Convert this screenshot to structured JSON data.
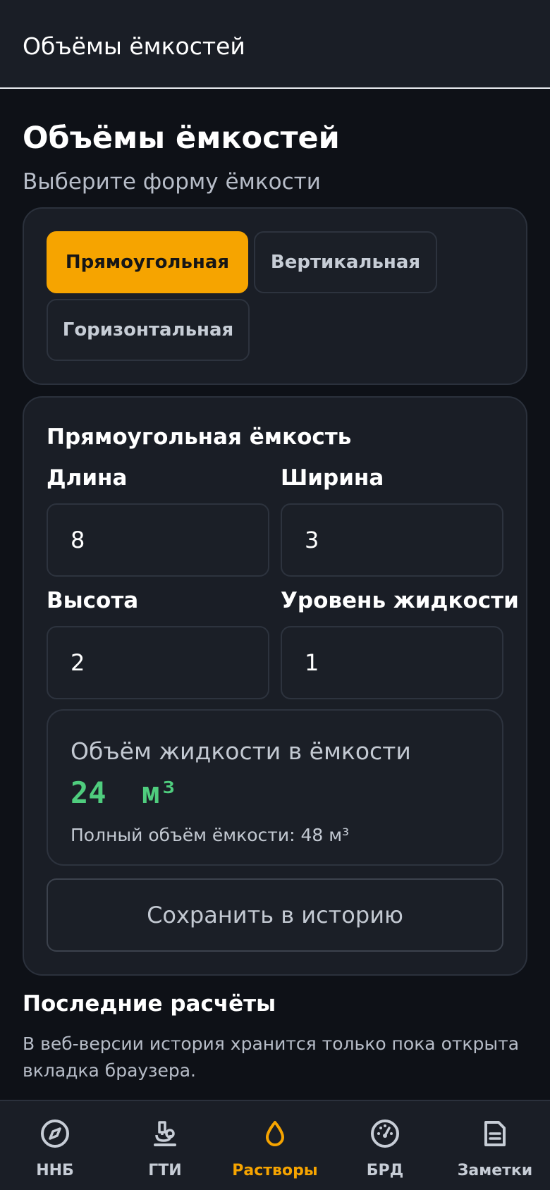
{
  "app_bar": {
    "title": "Объёмы ёмкостей"
  },
  "header": {
    "title": "Объёмы ёмкостей",
    "subtitle": "Выберите форму ёмкости"
  },
  "shapes": {
    "selected": "Прямоугольная",
    "rectangular": "Прямоугольная",
    "vertical": "Вертикальная",
    "horizontal": "Горизонтальная"
  },
  "calculator": {
    "title": "Прямоугольная ёмкость",
    "length": {
      "label": "Длина",
      "value": "8"
    },
    "width": {
      "label": "Ширина",
      "value": "3"
    },
    "height": {
      "label": "Высота",
      "value": "2"
    },
    "level": {
      "label": "Уровень жидкости",
      "value": "1"
    }
  },
  "result": {
    "label": "Объём жидкости в ёмкости",
    "value": "24  м³",
    "total": "Полный объём ёмкости: 48 м³"
  },
  "save_button": "Сохранить в историю",
  "history": {
    "title": "Последние расчёты",
    "note": "В веб-версии история хранится только пока открыта вкладка браузера."
  },
  "nav": {
    "active": "Растворы",
    "items": [
      {
        "label": "ННБ",
        "icon": "compass-icon"
      },
      {
        "label": "ГТИ",
        "icon": "microscope-icon"
      },
      {
        "label": "Растворы",
        "icon": "drop-icon"
      },
      {
        "label": "БРД",
        "icon": "gauge-icon"
      },
      {
        "label": "Заметки",
        "icon": "note-icon"
      }
    ]
  },
  "colors": {
    "accent": "#f6a400",
    "result": "#4fcd7e",
    "background": "#0e1117",
    "surface": "#1a1e26"
  }
}
